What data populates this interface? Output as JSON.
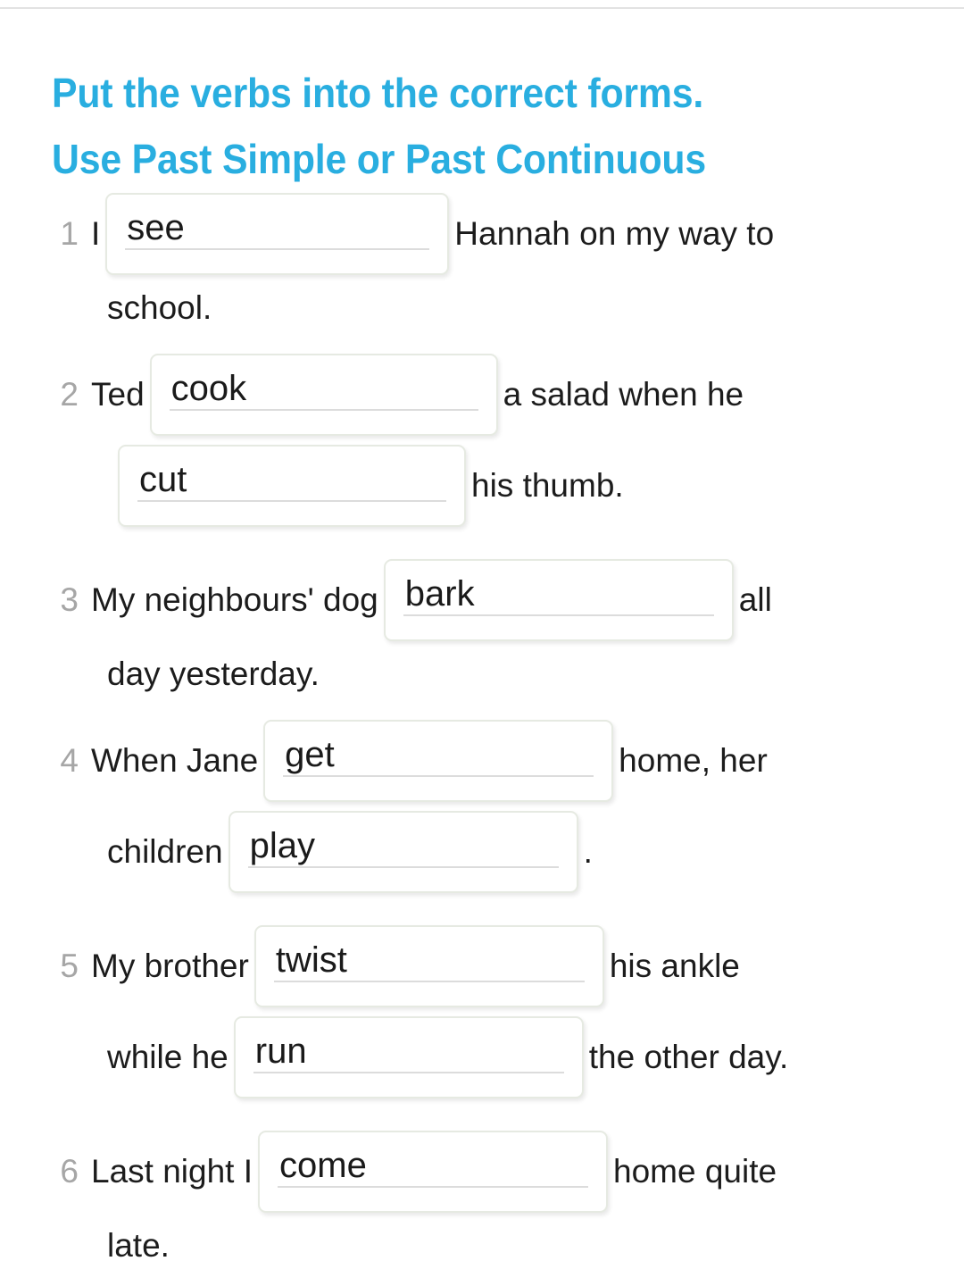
{
  "title": {
    "line1": "Put the verbs into the correct forms.",
    "line2": "Use Past Simple or Past Continuous",
    "color": "#29aee0"
  },
  "colors": {
    "title": "#29aee0",
    "body_text": "#1c1c1c",
    "number": "#a6a6a6",
    "box_border": "#e6eae2",
    "box_underline": "#dcdcdc",
    "page_background": "#ffffff",
    "top_rule": "#e2e2e2"
  },
  "questions": [
    {
      "number": "1",
      "before": "I",
      "blank1": "see",
      "middle": "Hannah on my way to",
      "after": "school."
    },
    {
      "number": "2",
      "before": "Ted",
      "blank1": "cook",
      "middle": "a salad when he",
      "blank2": "cut",
      "after": "his thumb."
    },
    {
      "number": "3",
      "before": "My neighbours' dog",
      "blank1": "bark",
      "middle": "all",
      "after": "day yesterday."
    },
    {
      "number": "4",
      "before": "When Jane",
      "blank1": "get",
      "middle": "home, her",
      "before2": "children",
      "blank2": "play",
      "after": "."
    },
    {
      "number": "5",
      "before": "My brother",
      "blank1": "twist",
      "middle": "his ankle",
      "before2": "while he",
      "blank2": "run",
      "after": "the other day."
    },
    {
      "number": "6",
      "before": "Last night I",
      "blank1": "come",
      "middle": "home quite",
      "after": "late."
    }
  ]
}
